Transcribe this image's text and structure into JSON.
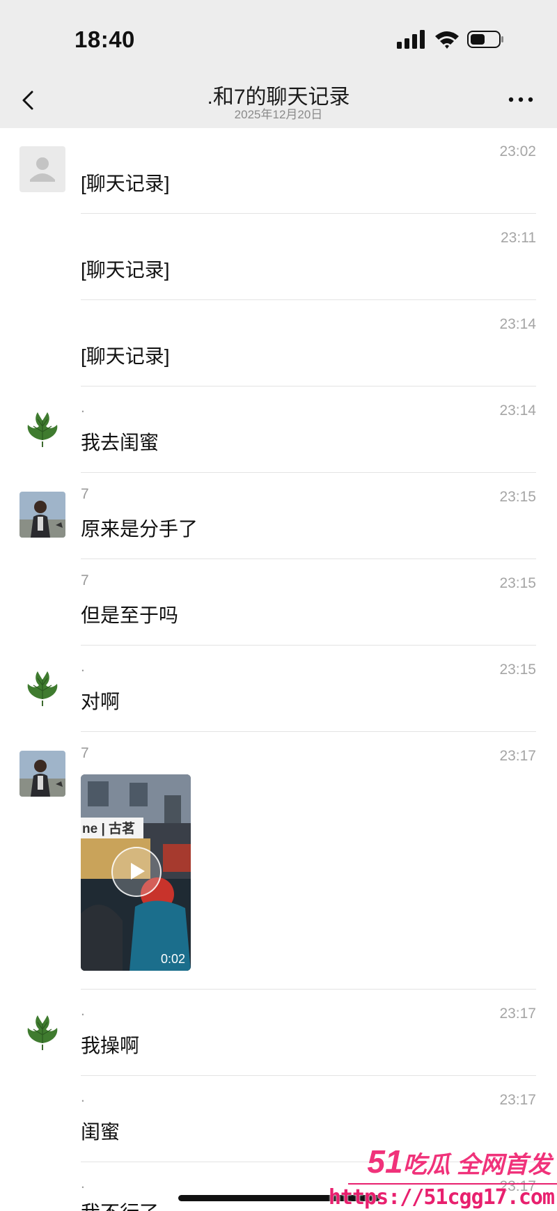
{
  "status": {
    "time": "18:40"
  },
  "header": {
    "title": ".和7的聊天记录",
    "subtitle": "2025年12月20日"
  },
  "messages": [
    {
      "avatar": "default-avatar",
      "sender": "",
      "time": "23:02",
      "text": "[聊天记录]"
    },
    {
      "avatar": "",
      "sender": "",
      "time": "23:11",
      "text": "[聊天记录]"
    },
    {
      "avatar": "",
      "sender": "",
      "time": "23:14",
      "text": "[聊天记录]"
    },
    {
      "avatar": "leaf-avatar",
      "sender": ".",
      "time": "23:14",
      "text": "我去闺蜜"
    },
    {
      "avatar": "photo-avatar",
      "sender": "7",
      "time": "23:15",
      "text": "原来是分手了"
    },
    {
      "avatar": "",
      "sender": "7",
      "time": "23:15",
      "text": "但是至于吗"
    },
    {
      "avatar": "leaf-avatar",
      "sender": ".",
      "time": "23:15",
      "text": "对啊"
    },
    {
      "avatar": "photo-avatar",
      "sender": "7",
      "time": "23:17",
      "video_duration": "0:02",
      "video_sign": "ne | 古茗"
    },
    {
      "avatar": "leaf-avatar",
      "sender": ".",
      "time": "23:17",
      "text": "我操啊"
    },
    {
      "avatar": "",
      "sender": ".",
      "time": "23:17",
      "text": "闺蜜"
    },
    {
      "avatar": "",
      "sender": ".",
      "time": "23:17",
      "text": "我不行了"
    }
  ],
  "watermark": {
    "brand_number": "51",
    "brand_text": "吃瓜 全网首发",
    "url": "https://51cgg17.com"
  },
  "colors": {
    "header_bg": "#ededed",
    "divider": "#e3e3e3",
    "watermark": "#e8206e"
  }
}
